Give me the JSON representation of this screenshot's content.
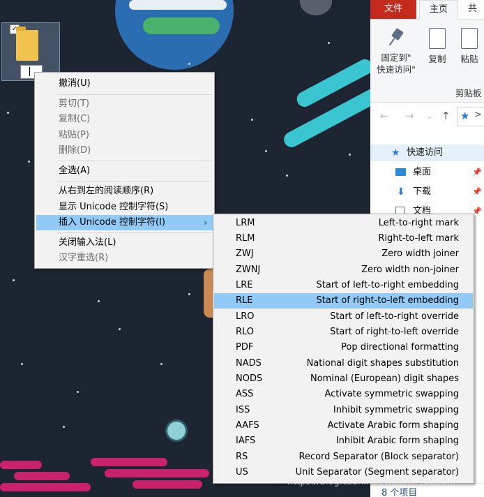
{
  "explorer": {
    "tabs": {
      "file": "文件",
      "home": "主页",
      "share": "共享"
    },
    "ribbon": {
      "pin_label": "固定到\"\n快速访问\"",
      "pin_label_1": "固定到\"",
      "pin_label_2": "快速访问\"",
      "copy_label": "复制",
      "paste_label": "粘贴",
      "clipboard_group": "剪贴板"
    },
    "nav": {
      "back": "←",
      "forward": "→",
      "dropdown": "⌄",
      "up": "↑",
      "address_sep": ">"
    },
    "pane": {
      "quick_access": "快速访问",
      "desktop": "桌面",
      "downloads": "下载",
      "documents": "文档"
    },
    "status": "8 个项目"
  },
  "desktop_icon": {
    "checkbox": "✓"
  },
  "menu1": {
    "items": [
      {
        "label": "撤消(U)",
        "enabled": true
      },
      {
        "label": "剪切(T)",
        "enabled": false
      },
      {
        "label": "复制(C)",
        "enabled": false
      },
      {
        "label": "粘贴(P)",
        "enabled": false
      },
      {
        "label": "删除(D)",
        "enabled": false
      },
      {
        "label": "全选(A)",
        "enabled": true
      },
      {
        "label": "从右到左的阅读顺序(R)",
        "enabled": true
      },
      {
        "label": "显示 Unicode 控制字符(S)",
        "enabled": true
      },
      {
        "label": "插入 Unicode 控制字符(I)",
        "enabled": true,
        "highlighted": true,
        "arrow": "›"
      },
      {
        "label": "关闭输入法(L)",
        "enabled": true
      },
      {
        "label": "汉字重选(R)",
        "enabled": false
      }
    ]
  },
  "menu2": {
    "items": [
      {
        "code": "LRM",
        "desc": "Left-to-right mark"
      },
      {
        "code": "RLM",
        "desc": "Right-to-left mark"
      },
      {
        "code": "ZWJ",
        "desc": "Zero width joiner"
      },
      {
        "code": "ZWNJ",
        "desc": "Zero width non-joiner"
      },
      {
        "code": "LRE",
        "desc": "Start of left-to-right embedding"
      },
      {
        "code": "RLE",
        "desc": "Start of right-to-left embedding",
        "highlighted": true
      },
      {
        "code": "LRO",
        "desc": "Start of left-to-right override"
      },
      {
        "code": "RLO",
        "desc": "Start of right-to-left override"
      },
      {
        "code": "PDF",
        "desc": "Pop directional formatting"
      },
      {
        "code": "NADS",
        "desc": "National digit shapes substitution"
      },
      {
        "code": "NODS",
        "desc": "Nominal (European) digit shapes"
      },
      {
        "code": "ASS",
        "desc": "Activate symmetric swapping"
      },
      {
        "code": "ISS",
        "desc": "Inhibit symmetric swapping"
      },
      {
        "code": "AAFS",
        "desc": "Activate Arabic form shaping"
      },
      {
        "code": "IAFS",
        "desc": "Inhibit Arabic form shaping"
      },
      {
        "code": "RS",
        "desc": "Record Separator (Block separator)"
      },
      {
        "code": "US",
        "desc": "Unit Separator (Segment separator)"
      }
    ]
  },
  "watermark": "https://blog.csdn.net/weixin_43823..."
}
